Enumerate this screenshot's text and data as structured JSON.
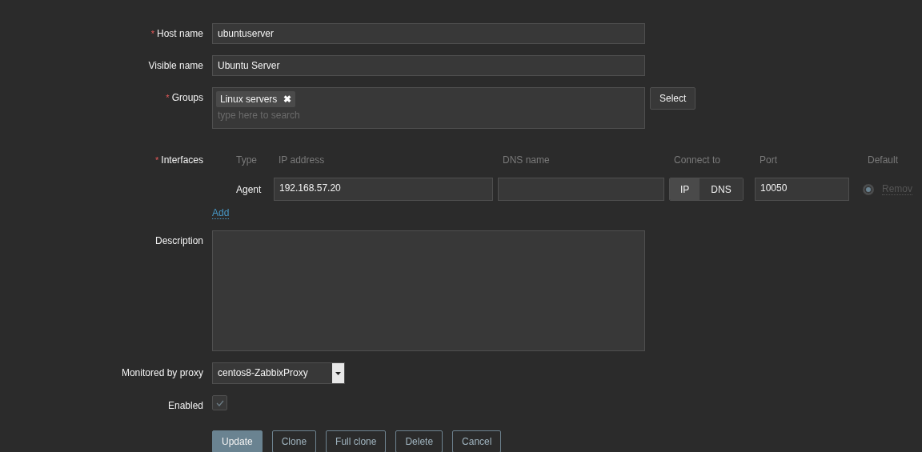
{
  "host_name": {
    "label": "Host name",
    "required_mark": "*",
    "value": "ubuntuserver"
  },
  "visible_name": {
    "label": "Visible name",
    "value": "Ubuntu Server"
  },
  "groups": {
    "label": "Groups",
    "required_mark": "*",
    "tags": [
      {
        "label": "Linux servers",
        "remove": "✖"
      }
    ],
    "placeholder": "type here to search",
    "select_button": "Select"
  },
  "interfaces": {
    "label": "Interfaces",
    "required_mark": "*",
    "columns": [
      "Type",
      "IP address",
      "DNS name",
      "Connect to",
      "Port",
      "Default"
    ],
    "rows": [
      {
        "type": "Agent",
        "ip": "192.168.57.20",
        "connect": [
          {
            "label": "IP",
            "selected": true
          },
          {
            "label": "DNS",
            "selected": false
          }
        ],
        "port": "10050",
        "default": true,
        "remove": "Remov"
      }
    ],
    "add": "Add"
  },
  "description": {
    "label": "Description"
  },
  "proxy": {
    "label": "Monitored by proxy",
    "value": "centos8-ZabbixProxy"
  },
  "enabled": {
    "label": "Enabled",
    "checked": true
  },
  "buttons": [
    {
      "label": "Update",
      "kind": "primary"
    },
    {
      "label": "Clone",
      "kind": "outline"
    },
    {
      "label": "Full clone",
      "kind": "outline"
    },
    {
      "label": "Delete",
      "kind": "outline"
    },
    {
      "label": "Cancel",
      "kind": "outline"
    }
  ]
}
